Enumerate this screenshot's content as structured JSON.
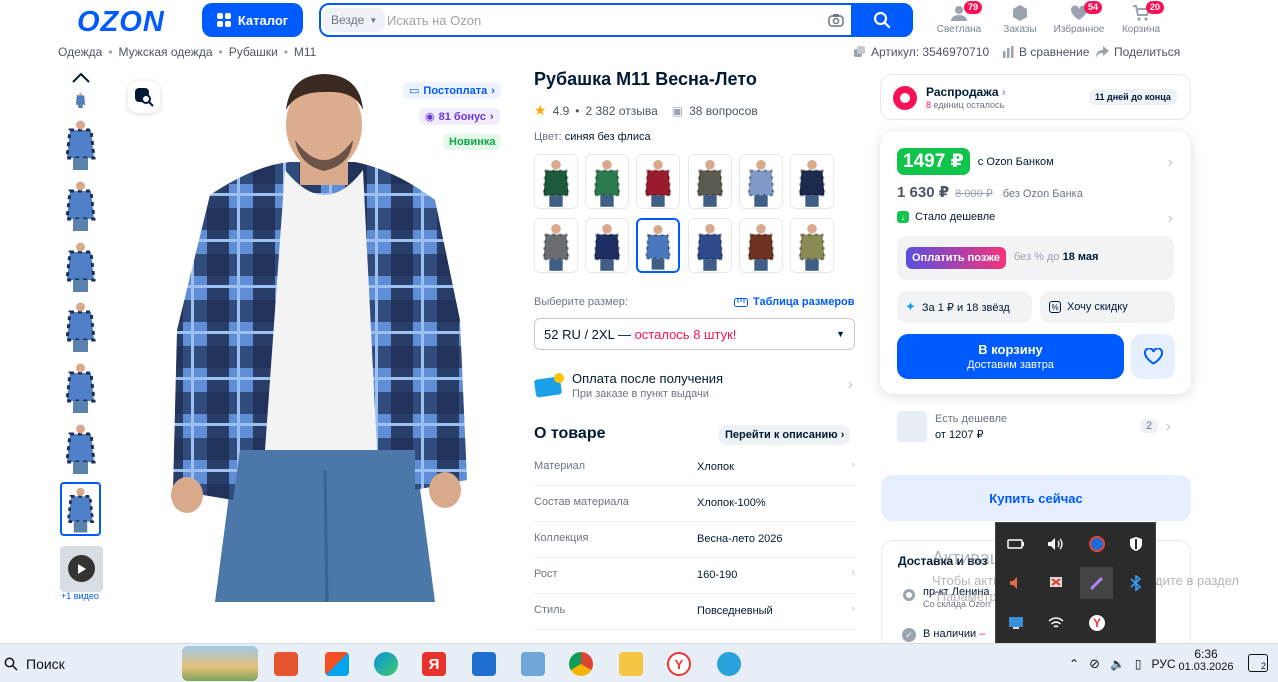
{
  "header": {
    "logo": "OZON",
    "catalog_label": "Каталог",
    "search_scope": "Везде",
    "search_placeholder": "Искать на Ozon",
    "user": {
      "label": "Светлана",
      "badge": "79"
    },
    "orders": {
      "label": "Заказы"
    },
    "favorites": {
      "label": "Избранное",
      "badge": "54"
    },
    "cart": {
      "label": "Корзина",
      "badge": "20"
    }
  },
  "breadcrumbs": [
    "Одежда",
    "Мужская одежда",
    "Рубашки",
    "M11"
  ],
  "topright": {
    "article": "Артикул: 3546970710",
    "compare": "В сравнение",
    "share": "Поделиться"
  },
  "gallery": {
    "video_label": "+1 видео",
    "postpay": "Постоплата",
    "bonus": "81 бонус",
    "new_badge": "Новинка"
  },
  "product": {
    "title": "Рубашка M11 Весна-Лето",
    "rating": "4.9",
    "reviews": "2 382 отзыва",
    "questions": "38 вопросов",
    "color_label": "Цвет:",
    "color_value": "синяя без флиса",
    "size_label": "Выберите размер:",
    "size_table": "Таблица размеров",
    "size_value": "52 RU / 2XL",
    "size_sep": " — ",
    "size_stock": "осталось 8 штук!",
    "pay_title": "Оплата после получения",
    "pay_sub": "При заказе в пункт выдачи",
    "about_title": "О товаре",
    "goto_desc": "Перейти к описанию",
    "props": [
      {
        "k": "Материал",
        "v": "Хлопок"
      },
      {
        "k": "Состав материала",
        "v": "Хлопок-100%"
      },
      {
        "k": "Коллекция",
        "v": "Весна-лето 2026"
      },
      {
        "k": "Рост",
        "v": "160-190"
      },
      {
        "k": "Стиль",
        "v": "Повседневный"
      }
    ]
  },
  "swatch_colors": [
    "#1d5a3a",
    "#2a7a4d",
    "#9a1c2a",
    "#5c5a4e",
    "#7f9ac8",
    "#1c2a4d",
    "#6a6e73",
    "#1d2f63",
    "#4a78bf",
    "#2f4a8a",
    "#6e3322",
    "#8a8a55"
  ],
  "sale": {
    "title": "Распродажа",
    "count": "8",
    "count_suffix": " единиц осталось",
    "days": "11 дней до конца"
  },
  "price": {
    "ozon_bank_price": "1497 ₽",
    "with_bank": "с Ozon Банком",
    "price": "1 630 ₽",
    "old_price": "8 000 ₽",
    "without_bank": "без Ozon Банка",
    "cheaper": "Стало дешевле",
    "later_btn": "Оплатить позже",
    "later_text": "без % до",
    "later_date": "18 мая",
    "stars": "За 1 ₽ и 18 звёзд",
    "discount": "Хочу скидку",
    "cart_btn": "В корзину",
    "cart_sub": "Доставим завтра",
    "cheaper_alt": "Есть дешевле",
    "cheaper_from": "от 1207 ₽",
    "cheaper_count": "2",
    "buy_now": "Купить сейчас"
  },
  "delivery": {
    "title": "Доставка и воз",
    "addr": "пр-кт Ленина",
    "addr_sub": "Со склада Ozon",
    "stock": "В наличии",
    "stock_dash": " – "
  },
  "watermark": {
    "title": "Активация Windows",
    "text": "Чтобы активировать Windows, перейдите в раздел \"Параметры\"."
  },
  "taskbar": {
    "search": "Поиск",
    "lang": "РУС",
    "time": "6:36",
    "date": "01.03.2026",
    "notif": "2"
  },
  "colors": {
    "brand": "#005bff",
    "green": "#10c44c",
    "pink": "#f91155"
  }
}
